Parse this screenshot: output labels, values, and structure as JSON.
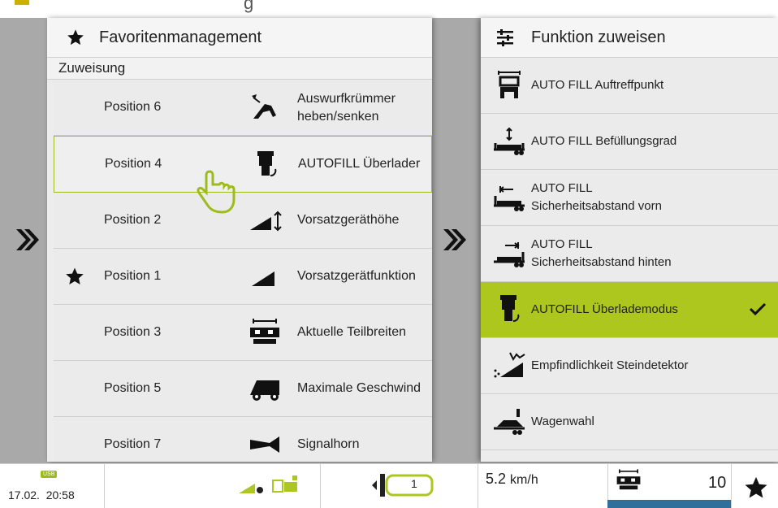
{
  "top_strip": {
    "text": "g"
  },
  "left_panel": {
    "title": "Favoritenmanagement",
    "subtitle": "Zuweisung",
    "rows": [
      {
        "position": "Position 6",
        "function": "Auswurfkrümmer heben/senken",
        "icon": "chute-icon",
        "favorite": false,
        "selected": false
      },
      {
        "position": "Position 4",
        "function": "AUTOFILL Überlader",
        "icon": "autofill-icon",
        "favorite": false,
        "selected": true
      },
      {
        "position": "Position 2",
        "function": "Vorsatzgeräthöhe",
        "icon": "header-height-icon",
        "favorite": false,
        "selected": false
      },
      {
        "position": "Position 1",
        "function": "Vorsatzgerätfunktion",
        "icon": "header-function-icon",
        "favorite": true,
        "selected": false
      },
      {
        "position": "Position 3",
        "function": "Aktuelle Teilbreiten",
        "icon": "partial-width-icon",
        "favorite": false,
        "selected": false
      },
      {
        "position": "Position 5",
        "function": "Maximale Geschwind",
        "icon": "max-speed-icon",
        "favorite": false,
        "selected": false
      },
      {
        "position": "Position 7",
        "function": "Signalhorn",
        "icon": "horn-icon",
        "favorite": false,
        "selected": false
      }
    ]
  },
  "right_panel": {
    "title": "Funktion zuweisen",
    "items": [
      {
        "label_line1": "AUTO FILL Auftreffpunkt",
        "label_line2": "",
        "icon": "impact-point-icon",
        "active": false
      },
      {
        "label_line1": "AUTO FILL Befüllungsgrad",
        "label_line2": "",
        "icon": "fill-level-icon",
        "active": false
      },
      {
        "label_line1": "AUTO FILL",
        "label_line2": "Sicherheitsabstand vorn",
        "icon": "safety-front-icon",
        "active": false
      },
      {
        "label_line1": "AUTO FILL",
        "label_line2": "Sicherheitsabstand hinten",
        "icon": "safety-rear-icon",
        "active": false
      },
      {
        "label_line1": "AUTOFILL Überlademodus",
        "label_line2": "",
        "icon": "autofill-icon",
        "active": true
      },
      {
        "label_line1": "Empfindlichkeit Steindetektor",
        "label_line2": "",
        "icon": "stone-detector-icon",
        "active": false
      },
      {
        "label_line1": "Wagenwahl",
        "label_line2": "",
        "icon": "wagon-select-icon",
        "active": false
      }
    ]
  },
  "status_bar": {
    "usb_label": "USB",
    "date": "17.02.",
    "time": "20:58",
    "speed_value": "5.2",
    "speed_unit": "km/h",
    "gear_value": "1",
    "counter": "10"
  },
  "colors": {
    "accent": "#aec71f",
    "selected_border": "#9dbb1f",
    "overlay": "#a9a9a9",
    "status_blue": "#2e6f9c"
  }
}
